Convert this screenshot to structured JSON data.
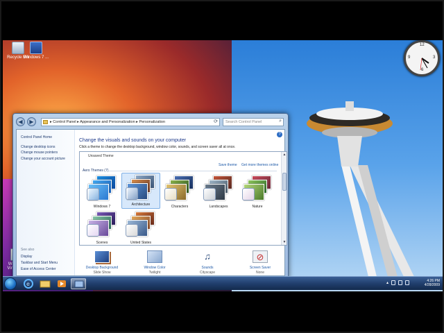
{
  "desktop": {
    "icons": [
      {
        "label": "Recycle Bin"
      },
      {
        "label": "Windows 7 ..."
      },
      {
        "label": "Windows Virtual PC"
      }
    ]
  },
  "window": {
    "nav_back": "◀",
    "nav_forward": "▶",
    "address": "▸ Control Panel ▸ Appearance and Personalization ▸ Personalization",
    "search_placeholder": "Search Control Panel",
    "controls": {
      "minimize": "–",
      "maximize": "□",
      "close": "✕"
    },
    "sidebar": {
      "home": "Control Panel Home",
      "links": [
        "Change desktop icons",
        "Change mouse pointers",
        "Change your account picture"
      ],
      "see_also_header": "See also",
      "see_also": [
        "Display",
        "Taskbar and Start Menu",
        "Ease of Access Center"
      ]
    },
    "heading": "Change the visuals and sounds on your computer",
    "subtext": "Click a theme to change the desktop background, window color, sounds, and screen saver all at once.",
    "unsaved_label": "Unsaved Theme",
    "save_theme": "Save theme",
    "get_more": "Get more themes online",
    "group_title": "Aero Themes (7)",
    "themes": [
      {
        "name": "Windows 7"
      },
      {
        "name": "Architecture"
      },
      {
        "name": "Characters"
      },
      {
        "name": "Landscapes"
      },
      {
        "name": "Nature"
      },
      {
        "name": "Scenes"
      },
      {
        "name": "United States"
      }
    ],
    "bottom": [
      {
        "label": "Desktop Background",
        "value": "Slide Show"
      },
      {
        "label": "Window Color",
        "value": "Twilight"
      },
      {
        "label": "Sounds",
        "value": "Cityscape"
      },
      {
        "label": "Screen Saver",
        "value": "None"
      }
    ]
  },
  "tray": {
    "time": "4:26 PM",
    "date": "4/28/2009"
  },
  "colors": {
    "accent": "#1e3a8a",
    "link": "#1e5aa8",
    "selection": "#d7e8fb"
  }
}
